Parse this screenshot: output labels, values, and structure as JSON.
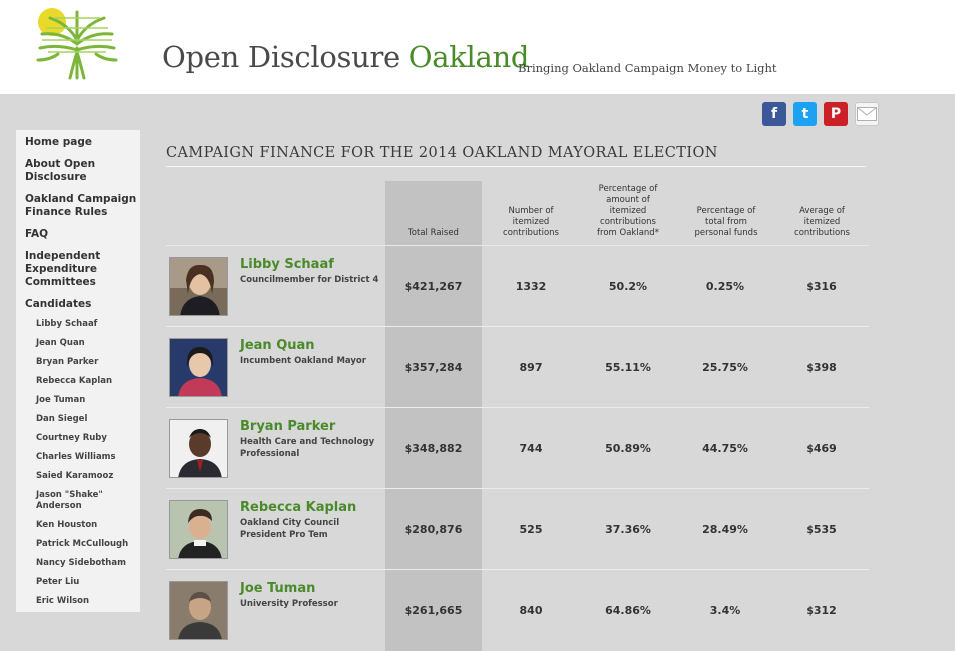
{
  "header": {
    "title_main": "Open Disclosure ",
    "title_accent": "Oakland",
    "tagline": "Bringing Oakland Campaign Money to Light"
  },
  "social": {
    "facebook": "f",
    "twitter": "t",
    "pinterest": "P"
  },
  "sidebar": {
    "items": [
      {
        "label": "Home page"
      },
      {
        "label": "About Open Disclosure"
      },
      {
        "label": "Oakland Campaign Finance Rules"
      },
      {
        "label": "FAQ"
      },
      {
        "label": "Independent Expenditure Committees"
      },
      {
        "label": "Candidates"
      }
    ],
    "candidates": [
      "Libby Schaaf",
      "Jean Quan",
      "Bryan Parker",
      "Rebecca Kaplan",
      "Joe Tuman",
      "Dan Siegel",
      "Courtney Ruby",
      "Charles Williams",
      "Saied Karamooz",
      "Jason \"Shake\" Anderson",
      "Ken Houston",
      "Patrick McCullough",
      "Nancy Sidebotham",
      "Peter Liu",
      "Eric Wilson"
    ]
  },
  "main": {
    "heading": "CAMPAIGN FINANCE FOR THE 2014 OAKLAND MAYORAL ELECTION",
    "columns": [
      "Total Raised",
      "Number of itemized contributions",
      "Percentage of amount of itemized contributions from Oakland*",
      "Percentage of total from personal funds",
      "Average of itemized contributions"
    ],
    "rows": [
      {
        "name": "Libby Schaaf",
        "role": "Councilmember for District 4",
        "total": "$421,267",
        "count": "1332",
        "pct_oakland": "50.2%",
        "pct_personal": "0.25%",
        "average": "$316"
      },
      {
        "name": "Jean Quan",
        "role": "Incumbent Oakland Mayor",
        "total": "$357,284",
        "count": "897",
        "pct_oakland": "55.11%",
        "pct_personal": "25.75%",
        "average": "$398"
      },
      {
        "name": "Bryan Parker",
        "role": "Health Care and Technology Professional",
        "total": "$348,882",
        "count": "744",
        "pct_oakland": "50.89%",
        "pct_personal": "44.75%",
        "average": "$469"
      },
      {
        "name": "Rebecca Kaplan",
        "role": "Oakland City Council President Pro Tem",
        "total": "$280,876",
        "count": "525",
        "pct_oakland": "37.36%",
        "pct_personal": "28.49%",
        "average": "$535"
      },
      {
        "name": "Joe Tuman",
        "role": "University Professor",
        "total": "$261,665",
        "count": "840",
        "pct_oakland": "64.86%",
        "pct_personal": "3.4%",
        "average": "$312"
      }
    ]
  },
  "colors": {
    "accent": "#4a8a2a",
    "background": "#d8d8d8",
    "total_column": "#c2c2c2"
  }
}
